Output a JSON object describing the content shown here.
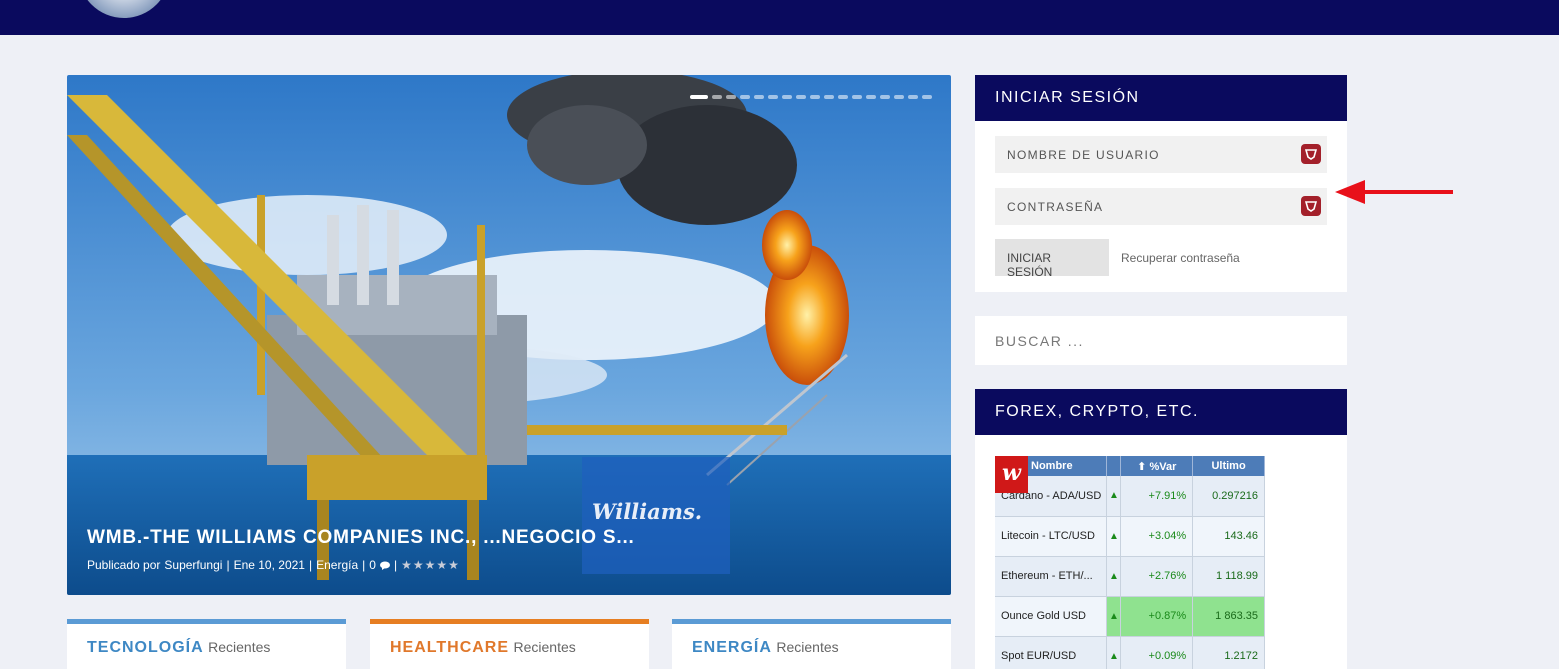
{
  "hero": {
    "title": "WMB.-THE WILLIAMS COMPANIES INC., ...NEGOCIO S...",
    "meta": {
      "prefix": "Publicado por",
      "author": "Superfungi",
      "date": "Ene 10, 2021",
      "category": "Energía",
      "comments": "0"
    },
    "rating_stars": "★★★★★",
    "logo_text": "Williams.",
    "slide_count": 17,
    "active_slide": 1
  },
  "categories": [
    {
      "title": "TECNOLOGÍA",
      "suffix": "Recientes",
      "color": "#5b9bd5"
    },
    {
      "title": "HEALTHCARE",
      "suffix": "Recientes",
      "color": "#e67e22"
    },
    {
      "title": "ENERGÍA",
      "suffix": "Recientes",
      "color": "#5b9bd5"
    }
  ],
  "login": {
    "heading": "INICIAR SESIÓN",
    "username_placeholder": "NOMBRE DE USUARIO",
    "password_placeholder": "CONTRASEÑA",
    "submit_label": "INICIAR SESIÓN",
    "recover_label": "Recuperar contraseña"
  },
  "search": {
    "placeholder": "BUSCAR ..."
  },
  "forex": {
    "heading": "FOREX, CRYPTO, ETC.",
    "badge": "w",
    "columns": {
      "name": "Nombre",
      "var": "%Var",
      "last": "Ultimo"
    },
    "rows": [
      {
        "name": "Cardano - ADA/USD",
        "var": "+7.91%",
        "last": "0.297216"
      },
      {
        "name": "Litecoin - LTC/USD",
        "var": "+3.04%",
        "last": "143.46"
      },
      {
        "name": "Ethereum - ETH/...",
        "var": "+2.76%",
        "last": "1 118.99"
      },
      {
        "name": "Ounce Gold USD",
        "var": "+0.87%",
        "last": "1 863.35"
      },
      {
        "name": "Spot EUR/USD",
        "var": "+0.09%",
        "last": "1.2172"
      }
    ]
  },
  "colors": {
    "navy": "#0a0a5e",
    "annotation_arrow": "#e8101a"
  }
}
